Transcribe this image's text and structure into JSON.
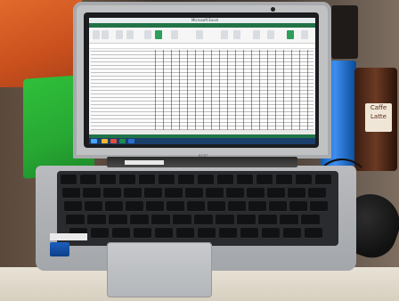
{
  "scene": {
    "description_tags": [
      "laptop",
      "spreadsheet",
      "desk"
    ],
    "colors": {
      "excel_green": "#217346",
      "taskbar_blue": "#1a3f6b",
      "laptop_silver": "#bfc1c3",
      "orange_box": "#e26a2c",
      "green_binder": "#2fbf3a"
    }
  },
  "screen": {
    "window_title": "Microsoft Excel"
  },
  "laptop": {
    "brand": "acer"
  },
  "cup": {
    "label": "Caffe Latte"
  }
}
